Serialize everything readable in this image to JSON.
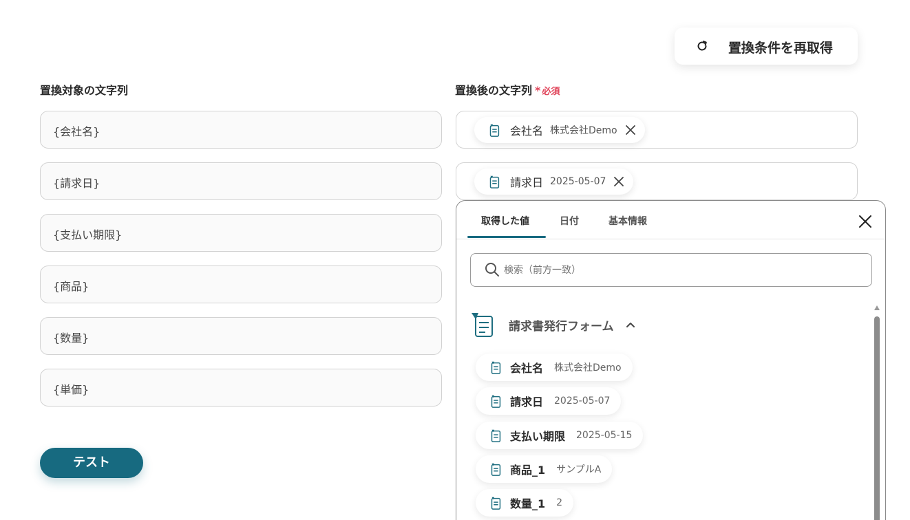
{
  "header": {
    "refresh_label": "置換条件を再取得",
    "refresh_icon": "refresh-icon"
  },
  "left": {
    "label": "置換対象の文字列",
    "fields": [
      "{会社名}",
      "{請求日}",
      "{支払い期限}",
      "{商品}",
      "{数量}",
      "{単価}"
    ]
  },
  "right": {
    "label": "置換後の文字列",
    "required_mark": "*",
    "required_text": "必須",
    "fields": [
      {
        "name": "会社名",
        "value": "株式会社Demo"
      },
      {
        "name": "請求日",
        "value": "2025-05-07"
      }
    ]
  },
  "test_button": "テスト",
  "panel": {
    "tabs": [
      "取得した値",
      "日付",
      "基本情報"
    ],
    "active_tab": 0,
    "search": {
      "placeholder": "検索（前方一致）",
      "value": ""
    },
    "group": {
      "label": "請求書発行フォーム",
      "expanded": true,
      "items": [
        {
          "name": "会社名",
          "value": "株式会社Demo"
        },
        {
          "name": "請求日",
          "value": "2025-05-07"
        },
        {
          "name": "支払い期限",
          "value": "2025-05-15"
        },
        {
          "name": "商品_1",
          "value": "サンプルA"
        },
        {
          "name": "数量_1",
          "value": "2"
        }
      ]
    }
  },
  "colors": {
    "accent": "#176a80",
    "required": "#e0445a",
    "icon": "#1e6e80"
  }
}
